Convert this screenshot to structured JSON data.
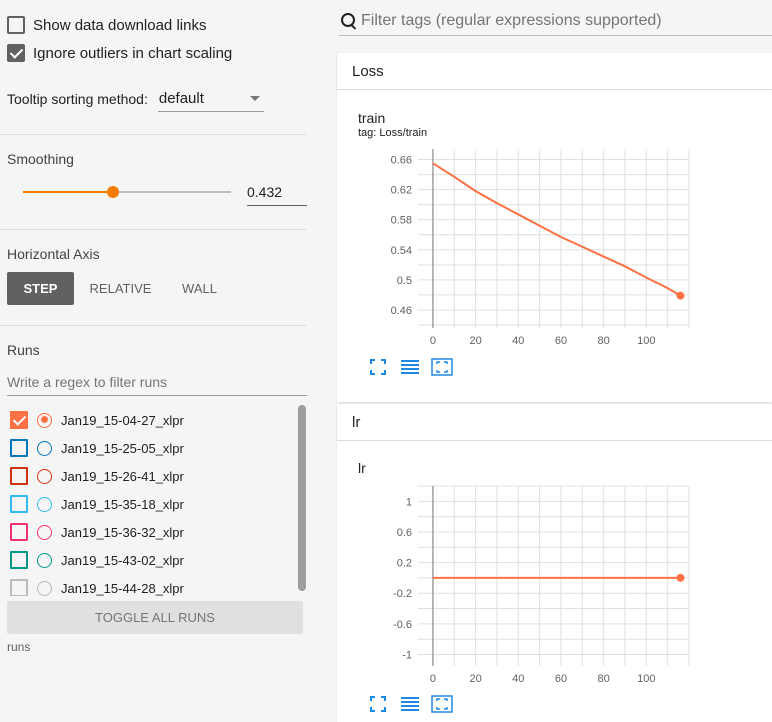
{
  "sidebar": {
    "show_download_links": {
      "label": "Show data download links",
      "checked": false
    },
    "ignore_outliers": {
      "label": "Ignore outliers in chart scaling",
      "checked": true
    },
    "tooltip": {
      "label": "Tooltip sorting method:",
      "value": "default"
    },
    "smoothing": {
      "label": "Smoothing",
      "value": "0.432",
      "fraction": 0.432
    },
    "horizontal_axis": {
      "label": "Horizontal Axis",
      "options": [
        "STEP",
        "RELATIVE",
        "WALL"
      ],
      "selected": "STEP"
    },
    "runs": {
      "label": "Runs",
      "filter_placeholder": "Write a regex to filter runs",
      "items": [
        {
          "name": "Jan19_15-04-27_xlpr",
          "color": "#ff7043",
          "checked": true,
          "selected": true
        },
        {
          "name": "Jan19_15-25-05_xlpr",
          "color": "#0077bb",
          "checked": false,
          "selected": false
        },
        {
          "name": "Jan19_15-26-41_xlpr",
          "color": "#cc3311",
          "checked": false,
          "selected": false
        },
        {
          "name": "Jan19_15-35-18_xlpr",
          "color": "#33bbee",
          "checked": false,
          "selected": false
        },
        {
          "name": "Jan19_15-36-32_xlpr",
          "color": "#ee3377",
          "checked": false,
          "selected": false
        },
        {
          "name": "Jan19_15-43-02_xlpr",
          "color": "#009988",
          "checked": false,
          "selected": false
        },
        {
          "name": "Jan19_15-44-28_xlpr",
          "color": "#bbbbbb",
          "checked": false,
          "selected": false
        }
      ],
      "toggle_all_label": "TOGGLE ALL RUNS",
      "footer": "runs"
    }
  },
  "main": {
    "search_placeholder": "Filter tags (regular expressions supported)",
    "groups": [
      {
        "name": "Loss"
      },
      {
        "name": "lr"
      }
    ]
  },
  "chart_data": [
    {
      "type": "line",
      "title": "train",
      "subtitle": "tag: Loss/train",
      "x_ticks": [
        0,
        20,
        40,
        60,
        80,
        100
      ],
      "y_ticks": [
        "0.66",
        "0.62",
        "0.58",
        "0.54",
        "0.5",
        "0.46"
      ],
      "xlim": [
        -7,
        120
      ],
      "ylim": [
        0.436,
        0.674
      ],
      "series": [
        {
          "color": "#ff7043",
          "x": [
            0,
            10,
            20,
            30,
            40,
            50,
            60,
            70,
            80,
            90,
            100,
            110,
            116
          ],
          "y": [
            0.655,
            0.637,
            0.618,
            0.602,
            0.587,
            0.572,
            0.557,
            0.544,
            0.531,
            0.518,
            0.503,
            0.489,
            0.479
          ]
        }
      ]
    },
    {
      "type": "line",
      "title": "lr",
      "x_ticks": [
        0,
        20,
        40,
        60,
        80,
        100
      ],
      "y_ticks": [
        "1",
        "0.6",
        "0.2",
        "-0.2",
        "-0.6",
        "-1"
      ],
      "xlim": [
        -7,
        120
      ],
      "ylim": [
        -1.15,
        1.2
      ],
      "series": [
        {
          "color": "#ff7043",
          "x": [
            0,
            116
          ],
          "y": [
            0.001,
            0.001
          ]
        }
      ]
    }
  ]
}
